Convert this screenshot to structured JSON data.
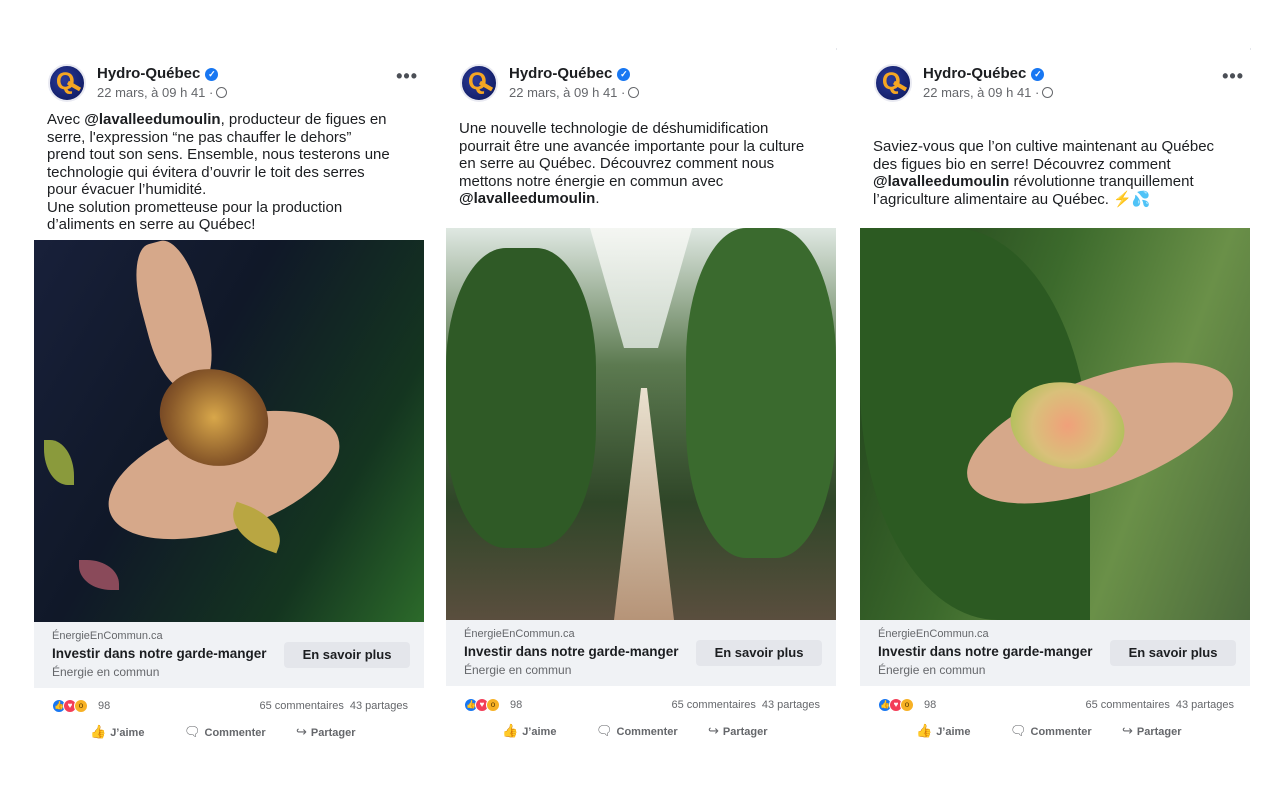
{
  "posts": [
    {
      "page_name": "Hydro-Québec",
      "timestamp": "22 mars, à 09 h 41 ·",
      "text_lines": [
        [
          {
            "t": "Avec "
          },
          {
            "t": "@lavalleedumoulin",
            "b": true
          },
          {
            "t": ", producteur de figues en"
          }
        ],
        [
          {
            "t": "serre, l'expression “ne pas chauffer le dehors”"
          }
        ],
        [
          {
            "t": "prend tout son sens. Ensemble, nous testerons une"
          }
        ],
        [
          {
            "t": "technologie qui évitera d’ouvrir le toit des serres"
          }
        ],
        [
          {
            "t": "pour évacuer l’humidité."
          }
        ],
        [
          {
            "t": "Une solution prometteuse pour la production"
          }
        ],
        [
          {
            "t": "d’aliments en serre au Québec!"
          }
        ]
      ],
      "cta": {
        "domain": "ÉnergieEnCommun.ca",
        "title": "Investir dans notre garde-manger",
        "subtitle": "Énergie en commun",
        "button": "En savoir plus"
      },
      "reactions_count": "98",
      "comments": "65 commentaires",
      "shares": "43 partages",
      "actions": {
        "like": "J’aime",
        "comment": "Commenter",
        "share": "Partager"
      }
    },
    {
      "page_name": "Hydro-Québec",
      "timestamp": "22 mars, à 09 h 41 ·",
      "text_lines": [
        [
          {
            "t": "Une nouvelle technologie de déshumidification"
          }
        ],
        [
          {
            "t": "pourrait être une avancée importante pour la culture"
          }
        ],
        [
          {
            "t": "en serre au Québec. Découvrez comment nous"
          }
        ],
        [
          {
            "t": "mettons notre énergie en commun avec"
          }
        ],
        [
          {
            "t": "@lavalleedumoulin",
            "b": true
          },
          {
            "t": "."
          }
        ]
      ],
      "cta": {
        "domain": "ÉnergieEnCommun.ca",
        "title": "Investir dans notre garde-manger",
        "subtitle": "Énergie en commun",
        "button": "En savoir plus"
      },
      "reactions_count": "98",
      "comments": "65 commentaires",
      "shares": "43 partages",
      "actions": {
        "like": "J’aime",
        "comment": "Commenter",
        "share": "Partager"
      }
    },
    {
      "page_name": "Hydro-Québec",
      "timestamp": "22 mars, à 09 h 41 ·",
      "text_lines": [
        [
          {
            "t": "Saviez-vous que l’on cultive maintenant au Québec"
          }
        ],
        [
          {
            "t": "des figues bio en serre! Découvrez comment"
          }
        ],
        [
          {
            "t": "@lavalleedumoulin",
            "b": true
          },
          {
            "t": " révolutionne tranquillement"
          }
        ],
        [
          {
            "t": "l’agriculture alimentaire au Québec. ⚡💦"
          }
        ]
      ],
      "cta": {
        "domain": "ÉnergieEnCommun.ca",
        "title": "Investir dans notre garde-manger",
        "subtitle": "Énergie en commun",
        "button": "En savoir plus"
      },
      "reactions_count": "98",
      "comments": "65 commentaires",
      "shares": "43 partages",
      "actions": {
        "like": "J’aime",
        "comment": "Commenter",
        "share": "Partager"
      }
    }
  ],
  "icons": {
    "avatar": "hydro-quebec-logo",
    "verified": "verified-badge-icon",
    "audience": "globe-icon",
    "menu": "more-options-icon",
    "reactions": [
      "like-reaction-icon",
      "love-reaction-icon",
      "wow-reaction-icon"
    ],
    "like": "thumbs-up-icon",
    "comment": "comment-bubble-icon",
    "share": "share-arrow-icon"
  },
  "colors": {
    "verified": "#1877f2",
    "like": "#1877f2",
    "love": "#f33e58",
    "wow": "#f7b125",
    "cta_bg": "#f0f2f5",
    "button_bg": "#e4e6eb"
  }
}
